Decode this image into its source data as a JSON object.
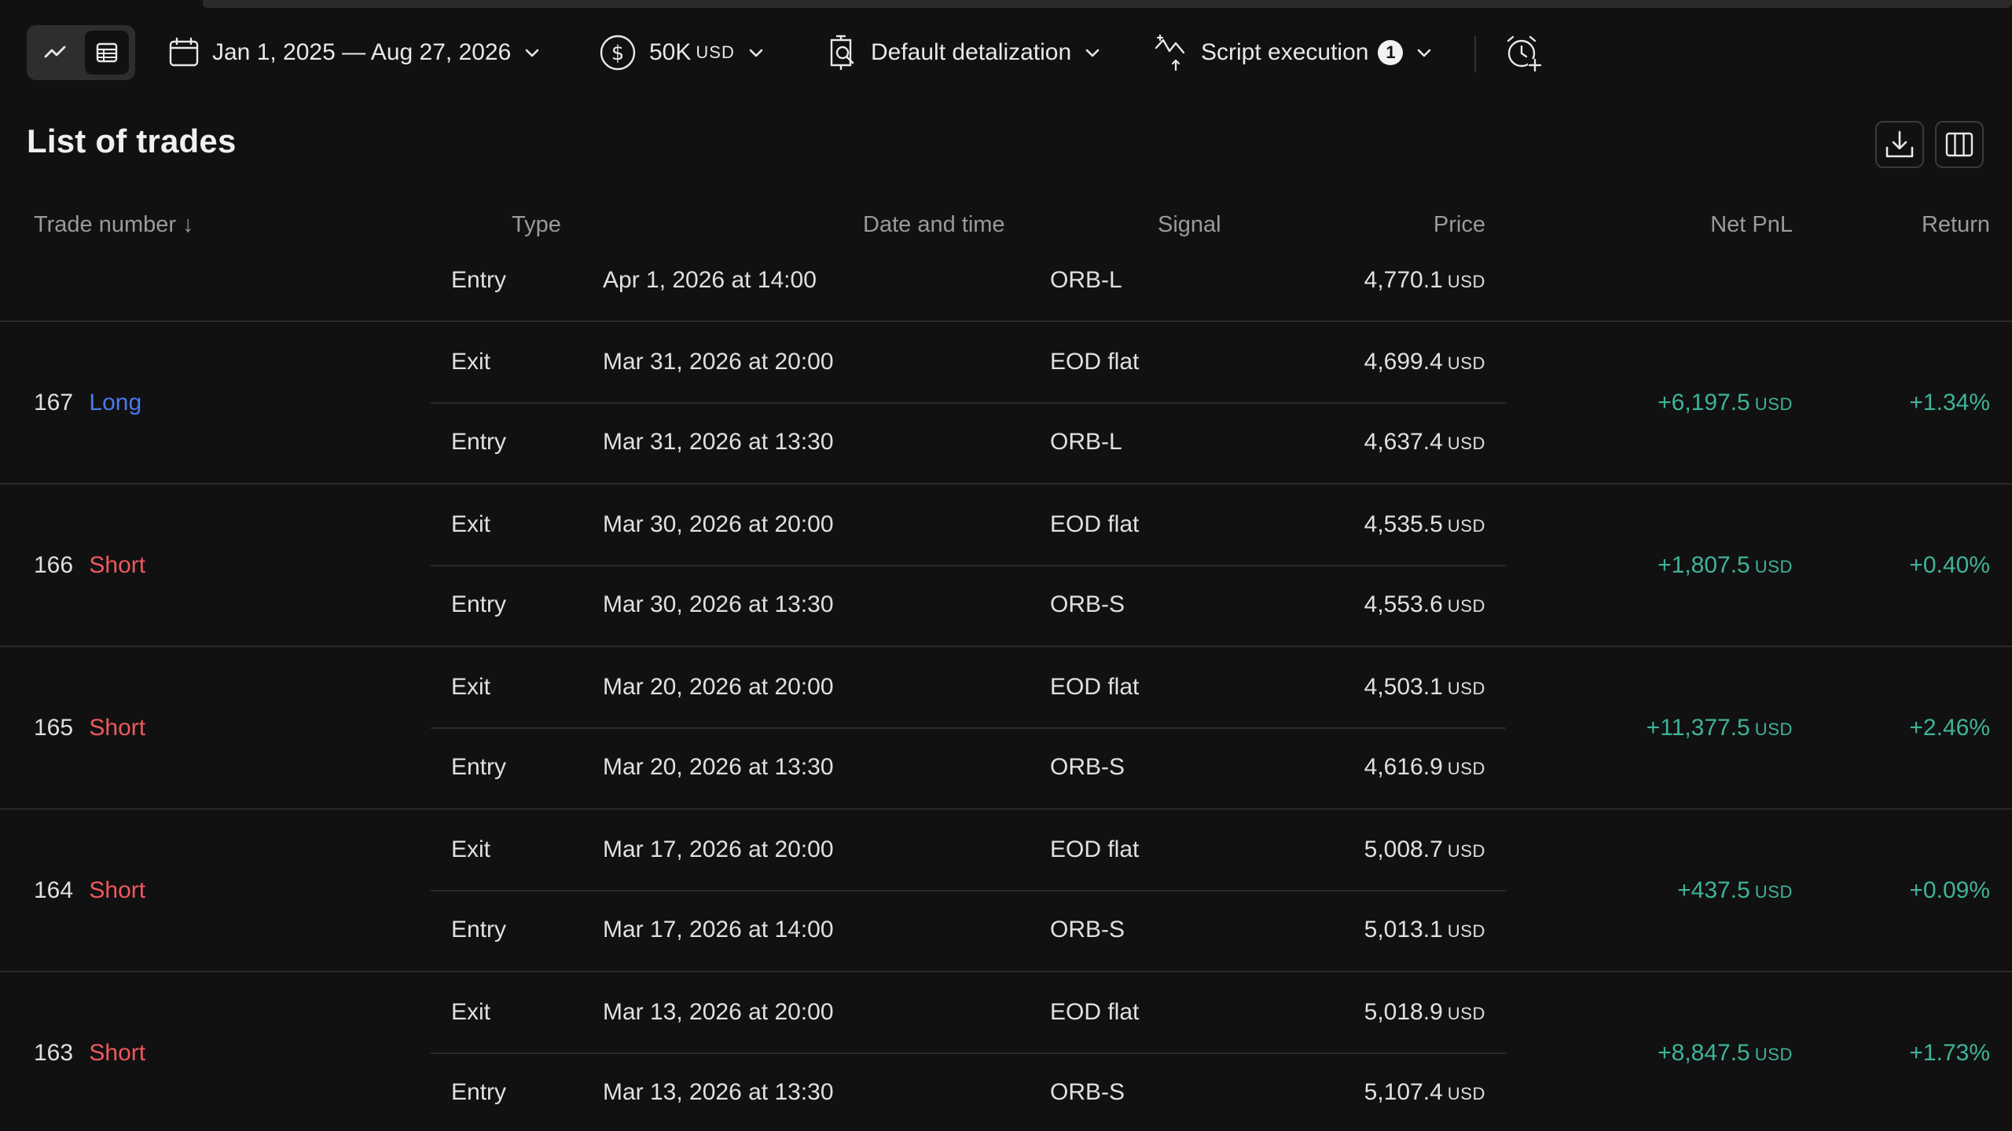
{
  "toolbar": {
    "date_range": "Jan 1, 2025 — Aug 27, 2026",
    "capital_value": "50K",
    "capital_unit": "USD",
    "detalization": "Default detalization",
    "script_execution": "Script execution",
    "script_execution_count": "1"
  },
  "page": {
    "title": "List of trades"
  },
  "table": {
    "headers": {
      "trade_number": "Trade number ↓",
      "type": "Type",
      "date_time": "Date and time",
      "signal": "Signal",
      "price": "Price",
      "net_pnl": "Net PnL",
      "return": "Return"
    },
    "unit": "USD",
    "partial_row": {
      "type": "Entry",
      "date": "Apr 1, 2026 at 14:00",
      "signal": "ORB-L",
      "price": "4,770.1"
    },
    "trades": [
      {
        "number": "167",
        "side": "Long",
        "exit": {
          "type": "Exit",
          "date": "Mar 31, 2026 at 20:00",
          "signal": "EOD flat",
          "price": "4,699.4"
        },
        "entry": {
          "type": "Entry",
          "date": "Mar 31, 2026 at 13:30",
          "signal": "ORB-L",
          "price": "4,637.4"
        },
        "net_pnl": "+6,197.5",
        "return": "+1.34%"
      },
      {
        "number": "166",
        "side": "Short",
        "exit": {
          "type": "Exit",
          "date": "Mar 30, 2026 at 20:00",
          "signal": "EOD flat",
          "price": "4,535.5"
        },
        "entry": {
          "type": "Entry",
          "date": "Mar 30, 2026 at 13:30",
          "signal": "ORB-S",
          "price": "4,553.6"
        },
        "net_pnl": "+1,807.5",
        "return": "+0.40%"
      },
      {
        "number": "165",
        "side": "Short",
        "exit": {
          "type": "Exit",
          "date": "Mar 20, 2026 at 20:00",
          "signal": "EOD flat",
          "price": "4,503.1"
        },
        "entry": {
          "type": "Entry",
          "date": "Mar 20, 2026 at 13:30",
          "signal": "ORB-S",
          "price": "4,616.9"
        },
        "net_pnl": "+11,377.5",
        "return": "+2.46%"
      },
      {
        "number": "164",
        "side": "Short",
        "exit": {
          "type": "Exit",
          "date": "Mar 17, 2026 at 20:00",
          "signal": "EOD flat",
          "price": "5,008.7"
        },
        "entry": {
          "type": "Entry",
          "date": "Mar 17, 2026 at 14:00",
          "signal": "ORB-S",
          "price": "5,013.1"
        },
        "net_pnl": "+437.5",
        "return": "+0.09%"
      },
      {
        "number": "163",
        "side": "Short",
        "exit": {
          "type": "Exit",
          "date": "Mar 13, 2026 at 20:00",
          "signal": "EOD flat",
          "price": "5,018.9"
        },
        "entry": {
          "type": "Entry",
          "date": "Mar 13, 2026 at 13:30",
          "signal": "ORB-S",
          "price": "5,107.4"
        },
        "net_pnl": "+8,847.5",
        "return": "+1.73%"
      }
    ]
  },
  "colors": {
    "positive": "#3fb39a",
    "long": "#4a78f0",
    "short": "#f0585e",
    "background": "#111111"
  },
  "icons": [
    "chart-line-icon",
    "table-icon",
    "calendar-icon",
    "dollar-circle-icon",
    "detalization-icon",
    "script-execution-icon",
    "alarm-add-icon",
    "download-icon",
    "columns-icon",
    "chevron-down-icon"
  ]
}
